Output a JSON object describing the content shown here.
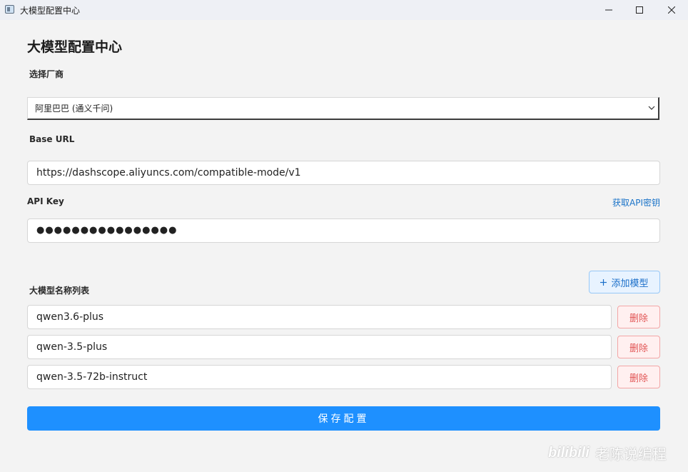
{
  "window": {
    "title": "大模型配置中心"
  },
  "page": {
    "title": "大模型配置中心"
  },
  "vendor": {
    "label": "选择厂商",
    "selected": "阿里巴巴 (通义千问)"
  },
  "base_url": {
    "label": "Base URL",
    "value": "https://dashscope.aliyuncs.com/compatible-mode/v1"
  },
  "api_key": {
    "label": "API Key",
    "value": "●●●●●●●●●●●●●●●●",
    "get_key_link": "获取API密钥"
  },
  "models": {
    "label": "大模型名称列表",
    "add_button": "添加模型",
    "delete_label": "删除",
    "items": [
      {
        "name": "qwen3.6-plus"
      },
      {
        "name": "qwen-3.5-plus"
      },
      {
        "name": "qwen-3.5-72b-instruct"
      }
    ]
  },
  "save_button": "保存配置",
  "watermark": {
    "logo": "bilibili",
    "text": "老陈说编程"
  },
  "colors": {
    "accent": "#1e90ff",
    "link": "#1a73c8",
    "danger": "#e25555"
  }
}
